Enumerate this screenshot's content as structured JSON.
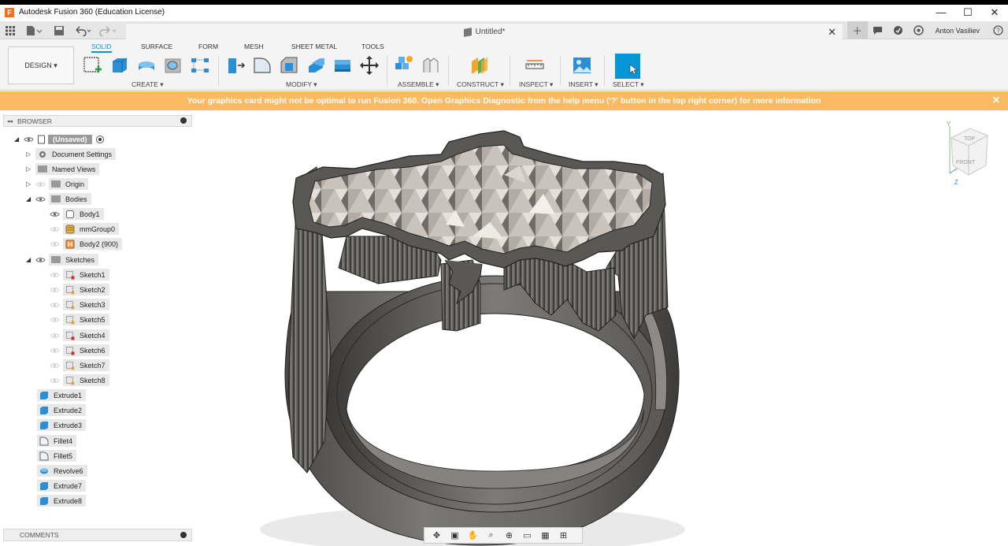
{
  "app": {
    "title": "Autodesk Fusion 360 (Education License)",
    "logo": "F"
  },
  "window_controls": {
    "minimize": "—",
    "maximize": "☐",
    "close": "✕"
  },
  "document": {
    "tab_title": "Untitled*",
    "close": "✕"
  },
  "user": {
    "name": "Anton Vasiliev"
  },
  "ribbon": {
    "workspace": "DESIGN ▾",
    "tabs": [
      "SOLID",
      "SURFACE",
      "FORM",
      "MESH",
      "SHEET METAL",
      "TOOLS"
    ],
    "groups": [
      "CREATE ▾",
      "MODIFY ▾",
      "ASSEMBLE ▾",
      "CONSTRUCT ▾",
      "INSPECT ▾",
      "INSERT ▾",
      "SELECT ▾"
    ]
  },
  "banner": {
    "text": "Your graphics card might not be optimal to run Fusion 360. Open Graphics Diagnostic from the help menu ('?' button in the top right corner) for more information",
    "close": "✕"
  },
  "browser": {
    "title": "BROWSER",
    "collapse": "◂◂",
    "root": "(Unsaved)",
    "items": [
      "Document Settings",
      "Named Views",
      "Origin",
      "Bodies",
      "Body1",
      "mmGroup0",
      "Body2 (900)",
      "Sketches",
      "Sketch1",
      "Sketch2",
      "Sketch3",
      "Sketch5",
      "Sketch4",
      "Sketch6",
      "Sketch7",
      "Sketch8",
      "Extrude1",
      "Extrude2",
      "Extrude3",
      "Fillet4",
      "Fillet5",
      "Revolve6",
      "Extrude7",
      "Extrude8"
    ]
  },
  "comments": {
    "title": "COMMENTS"
  },
  "viewcube": {
    "top": "TOP",
    "front": "FRONT",
    "axis_y": "Y",
    "axis_z": "Z"
  },
  "colors": {
    "accent": "#0696d7",
    "banner": "#fbb962",
    "model": "#6e6b68"
  }
}
